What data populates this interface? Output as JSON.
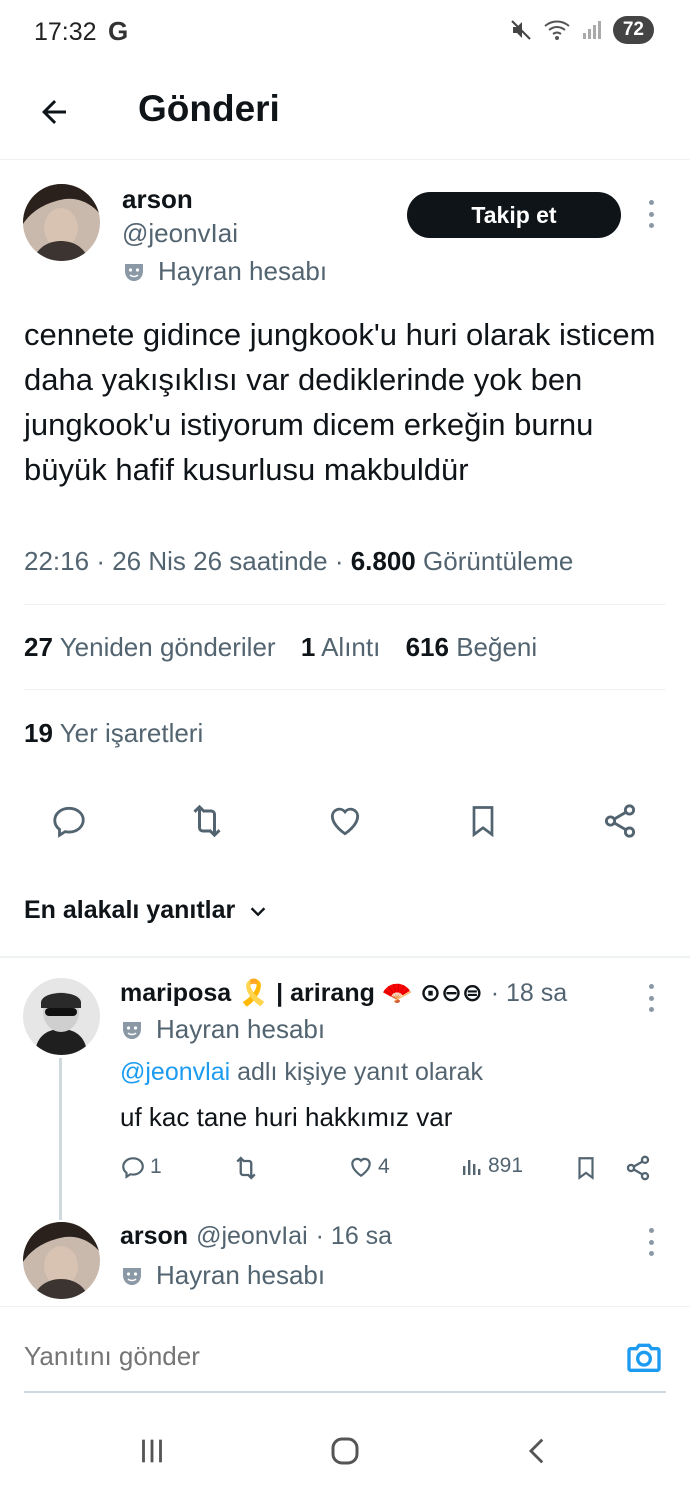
{
  "status_bar": {
    "time": "17:32",
    "google_letter": "G",
    "battery": "72"
  },
  "header": {
    "title": "Gönderi"
  },
  "tweet": {
    "author_name": "arson",
    "author_handle": "@jeonvIai",
    "badge_label": "Hayran hesabı",
    "follow_label": "Takip et",
    "text": "cennete gidince jungkook'u huri olarak isticem daha yakışıklısı var dediklerinde yok ben jungkook'u istiyorum dicem erkeğin burnu büyük hafif kusurlusu makbuldür",
    "time": "22:16",
    "date": "26 Nis 26 saatinde",
    "views_count": "6.800",
    "views_label": "Görüntüleme",
    "stats": {
      "retweets_count": "27",
      "retweets_label": "Yeniden gönderiler",
      "quotes_count": "1",
      "quotes_label": "Alıntı",
      "likes_count": "616",
      "likes_label": "Beğeni",
      "bookmarks_count": "19",
      "bookmarks_label": "Yer işaretleri"
    }
  },
  "sort": {
    "label": "En alakalı yanıtlar"
  },
  "replies": [
    {
      "name": "mariposa 🎗️ | arirang 🪭 ⊙⊖⊜",
      "time": "· 18 sa",
      "badge_label": "Hayran hesabı",
      "reply_to_mention": "@jeonvlai",
      "reply_to_suffix": " adlı kişiye yanıt olarak",
      "text": "uf kac tane huri hakkımız var",
      "reply_count": "1",
      "like_count": "4",
      "view_count": "891"
    },
    {
      "name": "arson",
      "handle": "@jeonvIai",
      "time": "· 16 sa",
      "badge_label": "Hayran hesabı"
    }
  ],
  "compose": {
    "placeholder": "Yanıtını gönder"
  },
  "colors": {
    "accent": "#1d9bf0",
    "text": "#0f1419",
    "muted": "#536471",
    "button": "#0f1419"
  }
}
